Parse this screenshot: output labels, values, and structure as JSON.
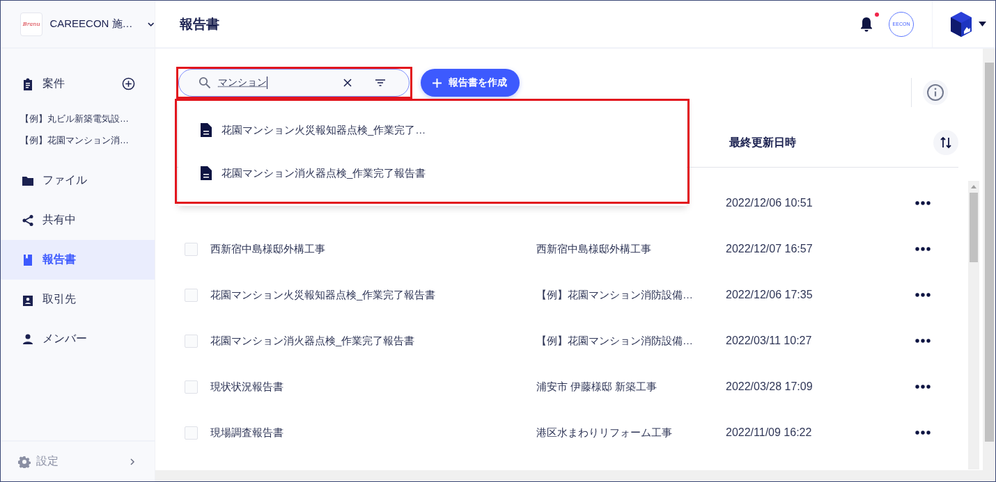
{
  "sidebar": {
    "logo_text": "Branu",
    "workspace": "CAREECON 施…",
    "items": [
      {
        "kind": "section",
        "label": "案件",
        "selected": false,
        "children": [
          {
            "label": "【例】丸ビル新築電気設…"
          },
          {
            "label": "【例】花園マンション消…"
          }
        ]
      },
      {
        "kind": "item",
        "label": "ファイル",
        "selected": false
      },
      {
        "kind": "item",
        "label": "共有中",
        "selected": false
      },
      {
        "kind": "item",
        "label": "報告書",
        "selected": true
      },
      {
        "kind": "item",
        "label": "取引先",
        "selected": false
      },
      {
        "kind": "item",
        "label": "メンバー",
        "selected": false
      }
    ],
    "settings": "設定"
  },
  "header": {
    "title": "報告書",
    "has_notification": true,
    "avatar_text": "EECON"
  },
  "search": {
    "value": "マンション"
  },
  "create_button": "報告書を作成",
  "suggestions": [
    {
      "label": "花園マンション火災報知器点検_作業完了…"
    },
    {
      "label": "花園マンション消火器点検_作業完了報告書"
    }
  ],
  "table": {
    "columns": [
      "最終更新日時"
    ],
    "rows": [
      {
        "updated": "2022/12/06 10:51"
      },
      {
        "name": "西新宿中島様邸外構工事",
        "project": "西新宿中島様邸外構工事",
        "updated": "2022/12/07 16:57",
        "checked": false
      },
      {
        "name": "花園マンション火災報知器点検_作業完了報告書",
        "project": "【例】花園マンション消防設備…",
        "updated": "2022/12/06 17:35",
        "checked": false
      },
      {
        "name": "花園マンション消火器点検_作業完了報告書",
        "project": "【例】花園マンション消防設備…",
        "updated": "2022/03/11 10:27",
        "checked": false
      },
      {
        "name": "現状状況報告書",
        "project": "浦安市 伊藤様邸 新築工事",
        "updated": "2022/03/28 17:09",
        "checked": false
      },
      {
        "name": "現場調査報告書",
        "project": "港区水まわりリフォーム工事",
        "updated": "2022/11/09 16:22",
        "checked": false
      }
    ]
  }
}
